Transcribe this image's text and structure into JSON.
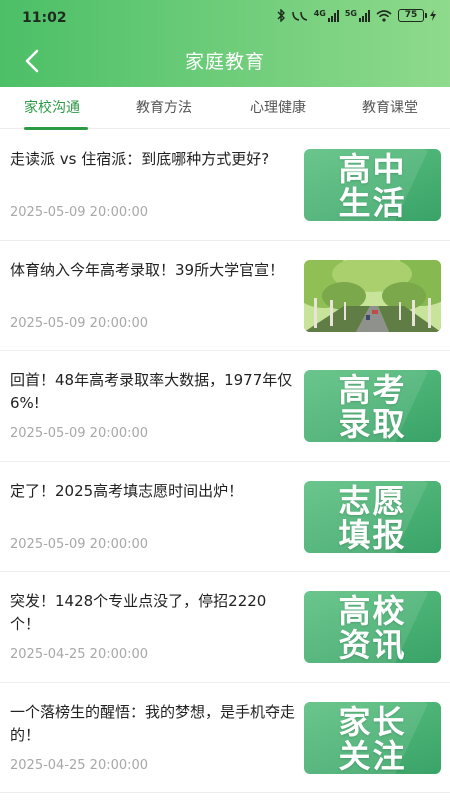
{
  "status_bar": {
    "time": "11:02",
    "net1": "4G",
    "net2": "5G",
    "battery": "75"
  },
  "header": {
    "title": "家庭教育",
    "colors": {
      "start": "#4cbf67",
      "end": "#8fda8c"
    }
  },
  "tabs": [
    {
      "label": "家校沟通",
      "active": true
    },
    {
      "label": "教育方法",
      "active": false
    },
    {
      "label": "心理健康",
      "active": false
    },
    {
      "label": "教育课堂",
      "active": false
    }
  ],
  "articles": [
    {
      "title": "走读派 vs 住宿派：到底哪种方式更好?",
      "date": "2025-05-09 20:00:00",
      "thumb": {
        "type": "text",
        "line1": "高中",
        "line2": "生活"
      }
    },
    {
      "title": "体育纳入今年高考录取！39所大学官宣！",
      "date": "2025-05-09 20:00:00",
      "thumb": {
        "type": "photo",
        "subject": "tree-lined-road"
      }
    },
    {
      "title": "回首！48年高考录取率大数据，1977年仅6%!",
      "date": "2025-05-09 20:00:00",
      "thumb": {
        "type": "text",
        "line1": "高考",
        "line2": "录取"
      }
    },
    {
      "title": "定了！2025高考填志愿时间出炉！",
      "date": "2025-05-09 20:00:00",
      "thumb": {
        "type": "text",
        "line1": "志愿",
        "line2": "填报"
      }
    },
    {
      "title": "突发！1428个专业点没了，停招2220个！",
      "date": "2025-04-25 20:00:00",
      "thumb": {
        "type": "text",
        "line1": "高校",
        "line2": "资讯"
      }
    },
    {
      "title": "一个落榜生的醒悟：我的梦想，是手机夺走的！",
      "date": "2025-04-25 20:00:00",
      "thumb": {
        "type": "text",
        "line1": "家长",
        "line2": "关注"
      }
    }
  ],
  "accent_color": "#2d9a46"
}
